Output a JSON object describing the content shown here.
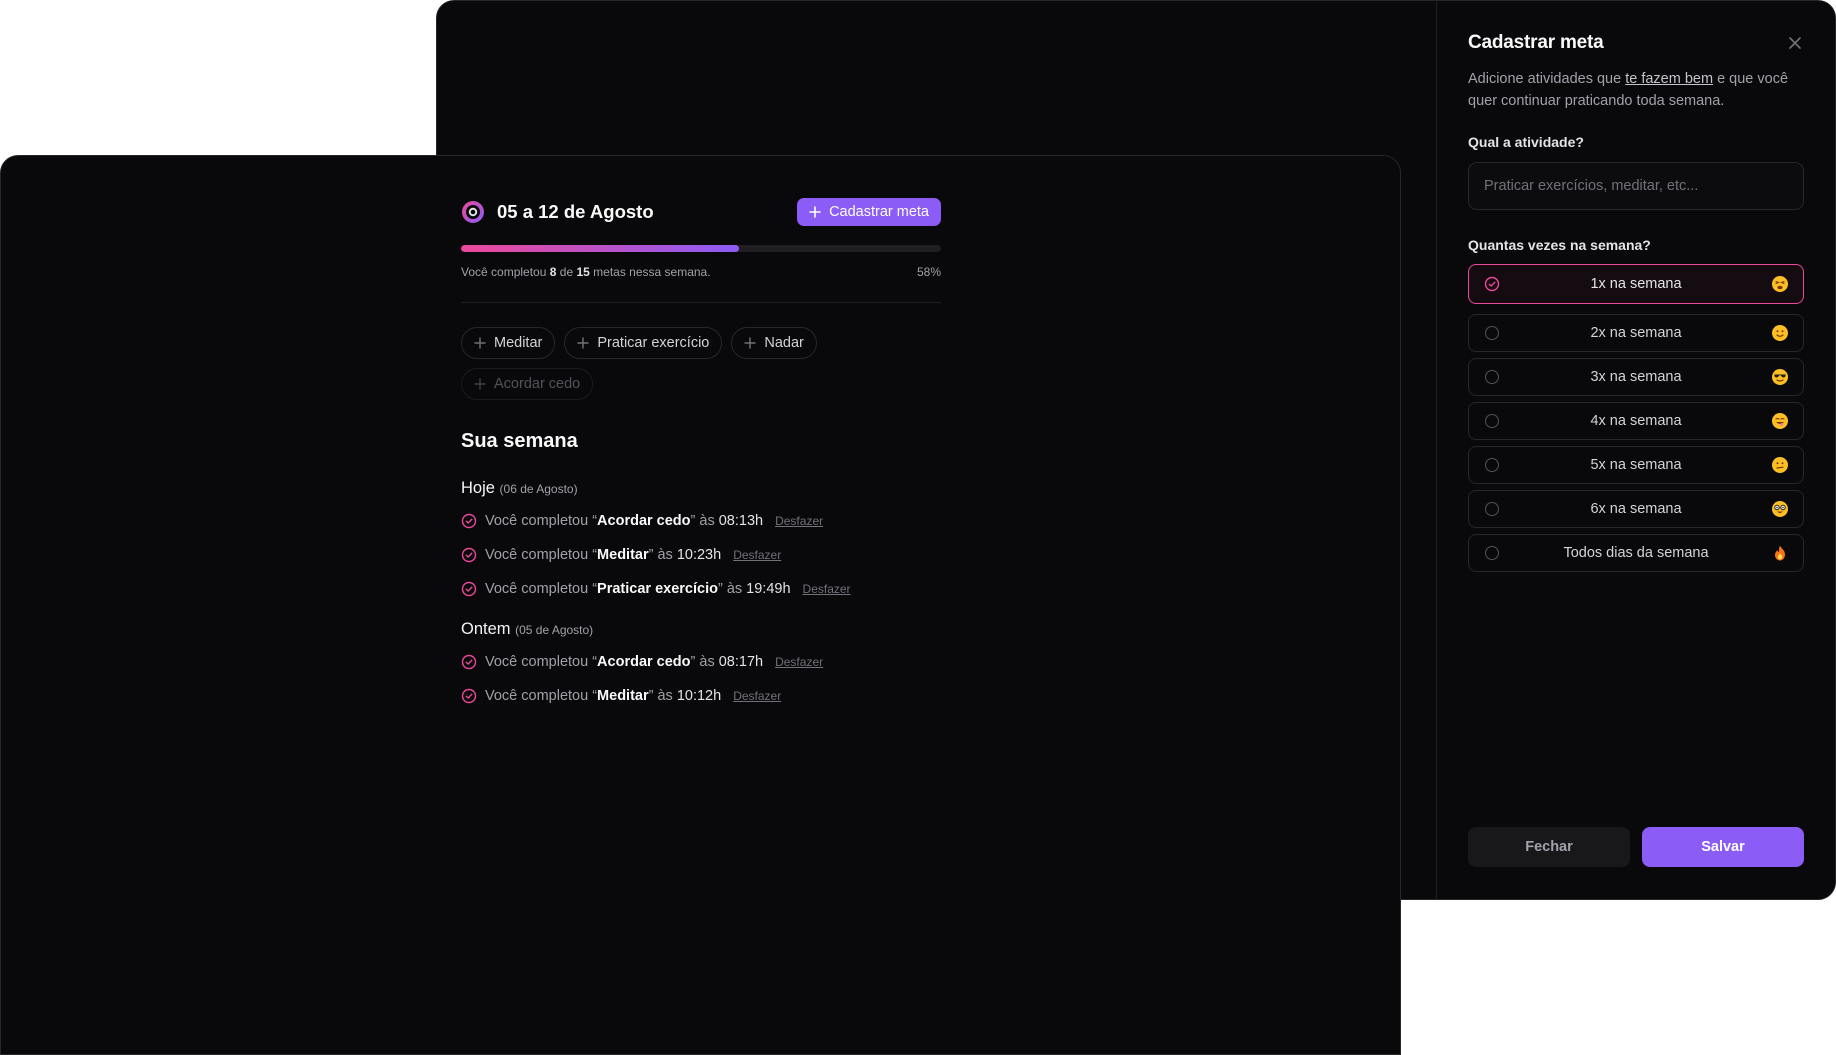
{
  "dashboard": {
    "week_range": "05 a 12 de Agosto",
    "add_goal_label": "Cadastrar meta",
    "progress": {
      "completed": 8,
      "total": 15,
      "percent_label": "58%",
      "fraction": 0.58,
      "text_prefix": "Você completou",
      "text_of": "de",
      "text_suffix": "metas nessa semana."
    },
    "quick_goals": [
      {
        "label": "Meditar",
        "disabled": false
      },
      {
        "label": "Praticar exercício",
        "disabled": false
      },
      {
        "label": "Nadar",
        "disabled": false
      },
      {
        "label": "Acordar cedo",
        "disabled": true
      }
    ],
    "summary_title": "Sua semana",
    "days": [
      {
        "label": "Hoje",
        "date": "(06 de Agosto)",
        "entries": [
          {
            "prefix": "Você completou “",
            "goal": "Acordar cedo",
            "mid": "” às",
            "time": "08:13h",
            "undo": "Desfazer"
          },
          {
            "prefix": "Você completou “",
            "goal": "Meditar",
            "mid": "” às",
            "time": "10:23h",
            "undo": "Desfazer"
          },
          {
            "prefix": "Você completou “",
            "goal": "Praticar exercício",
            "mid": "” às",
            "time": "19:49h",
            "undo": "Desfazer"
          }
        ]
      },
      {
        "label": "Ontem",
        "date": "(05 de Agosto)",
        "entries": [
          {
            "prefix": "Você completou “",
            "goal": "Acordar cedo",
            "mid": "” às",
            "time": "08:17h",
            "undo": "Desfazer"
          },
          {
            "prefix": "Você completou “",
            "goal": "Meditar",
            "mid": "” às",
            "time": "10:12h",
            "undo": "Desfazer"
          }
        ]
      }
    ]
  },
  "drawer": {
    "title": "Cadastrar meta",
    "desc_pre": "Adicione atividades que ",
    "desc_link": "te fazem bem",
    "desc_post": " e que você quer continuar praticando toda semana.",
    "activity_label": "Qual a atividade?",
    "activity_placeholder": "Praticar exercícios, meditar, etc...",
    "activity_value": "",
    "frequency_label": "Quantas vezes na semana?",
    "options": [
      {
        "label": "1x na semana",
        "emoji": "tired-face-emoji",
        "selected": true
      },
      {
        "label": "2x na semana",
        "emoji": "slightly-smiling-face-emoji",
        "selected": false
      },
      {
        "label": "3x na semana",
        "emoji": "sunglasses-face-emoji",
        "selected": false
      },
      {
        "label": "4x na semana",
        "emoji": "tongue-out-face-emoji",
        "selected": false
      },
      {
        "label": "5x na semana",
        "emoji": "grimacing-face-emoji",
        "selected": false
      },
      {
        "label": "6x na semana",
        "emoji": "nerd-face-emoji",
        "selected": false
      },
      {
        "label": "Todos dias da semana",
        "emoji": "fire-emoji",
        "selected": false
      }
    ],
    "close_label": "Fechar",
    "save_label": "Salvar"
  },
  "colors": {
    "accent": "#8b5cf6",
    "pink": "#ec4899",
    "background": "#09090b",
    "border": "#27272a"
  }
}
